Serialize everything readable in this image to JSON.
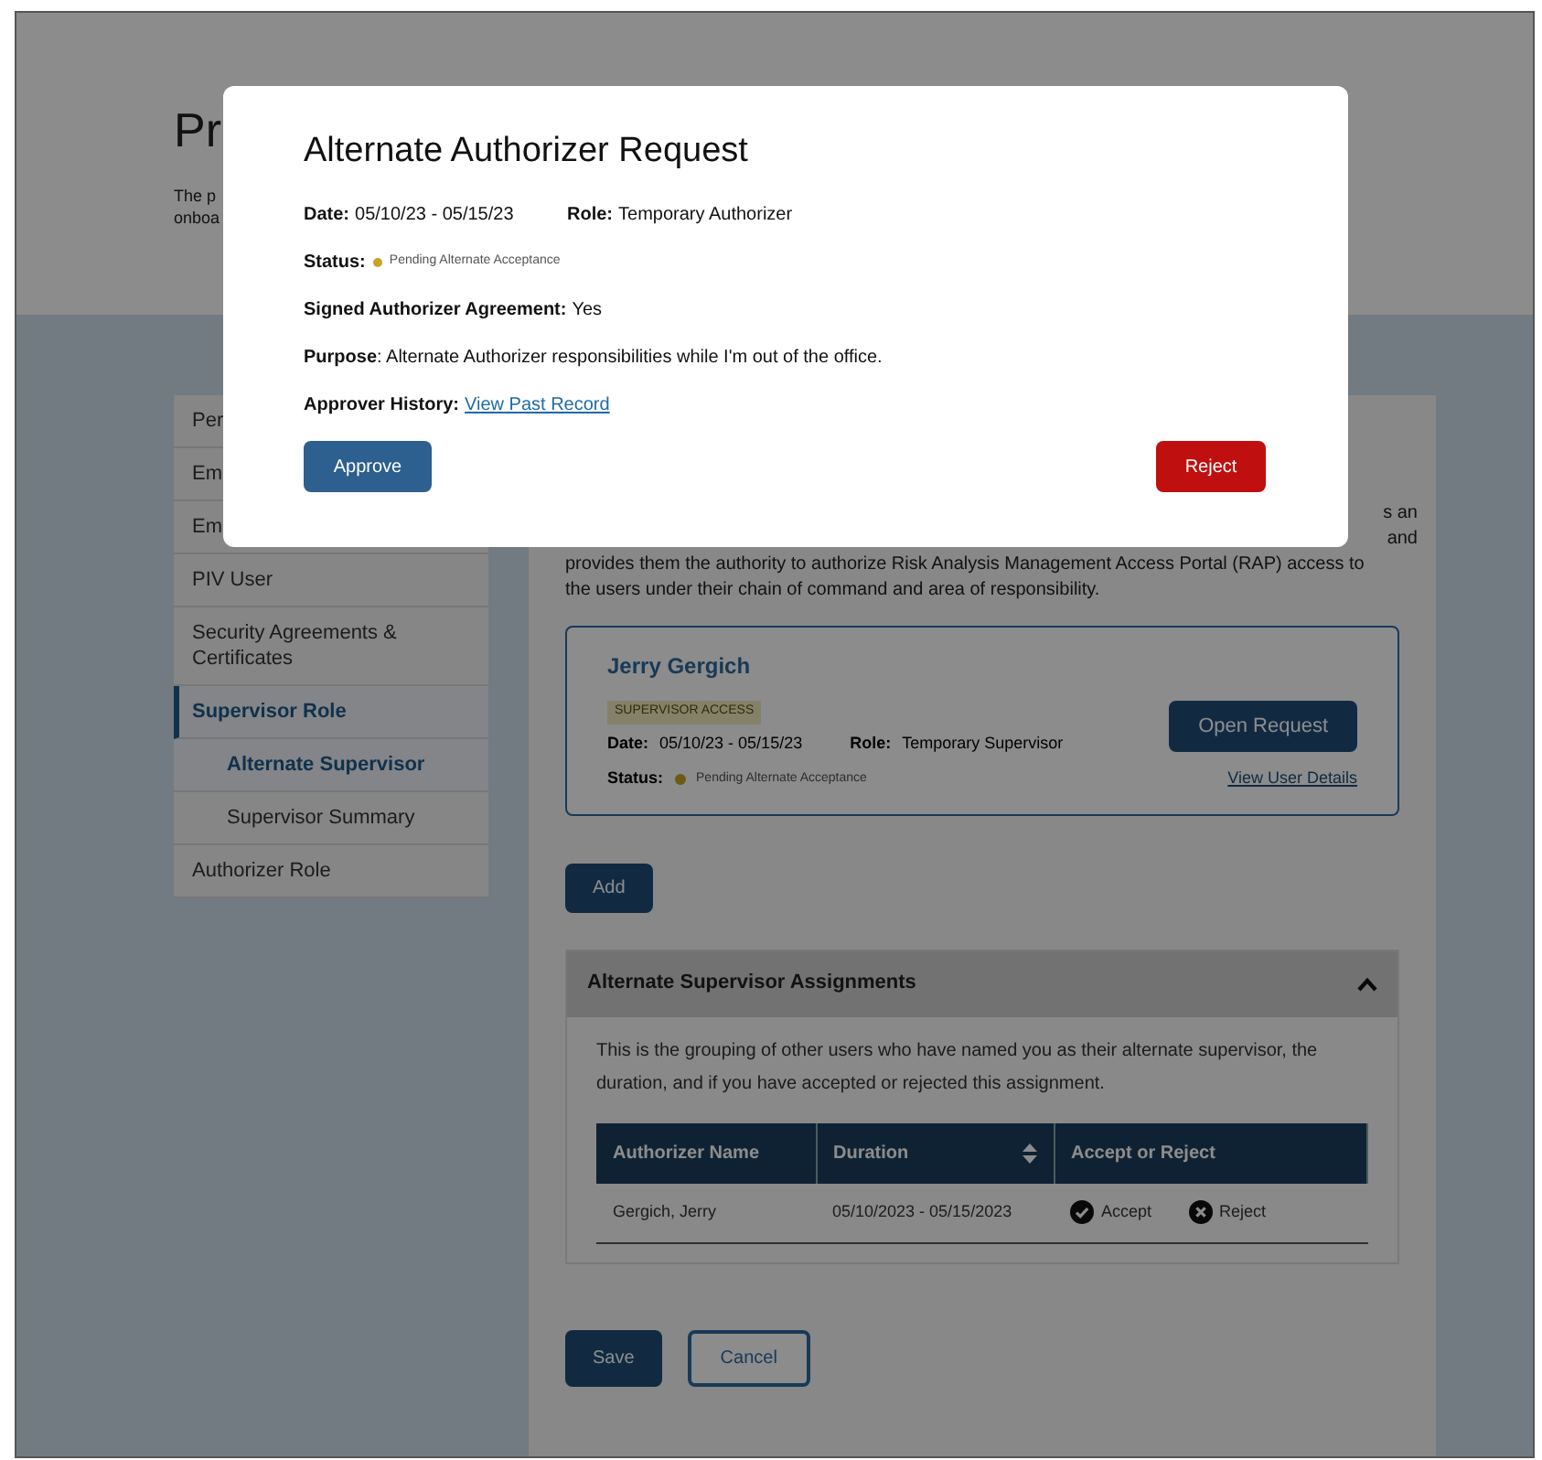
{
  "page": {
    "heading": "Pr",
    "intro_lines": [
      "The p",
      "onboa"
    ]
  },
  "sidebar": {
    "items": [
      {
        "label": "Per",
        "selected": false
      },
      {
        "label": "Em",
        "selected": false
      },
      {
        "label": "Em",
        "selected": false
      },
      {
        "label": "PIV User",
        "selected": false
      },
      {
        "label": "Security Agreements & Certificates",
        "selected": false
      },
      {
        "label": "Supervisor Role",
        "selected": true,
        "children": [
          {
            "label": "Alternate Supervisor",
            "selected": true
          },
          {
            "label": "Supervisor Summary",
            "selected": false
          }
        ]
      },
      {
        "label": "Authorizer Role",
        "selected": false
      }
    ]
  },
  "content": {
    "description_fragments": [
      "s an",
      "and"
    ],
    "description_lines": [
      "provides them the authority to authorize Risk Analysis Management Access Portal (RAP) access to",
      "the users under their chain of command and area of responsibility."
    ],
    "request_card": {
      "name": "Jerry Gergich",
      "badge": "SUPERVISOR ACCESS",
      "date_label": "Date:",
      "date": "05/10/23 - 05/15/23",
      "role_label": "Role:",
      "role": "Temporary Supervisor",
      "status_label": "Status:",
      "status": "Pending Alternate Acceptance",
      "open_button": "Open Request",
      "details_link": "View User Details"
    },
    "add_button": "Add",
    "accordion": {
      "title": "Alternate Supervisor Assignments",
      "expanded": true,
      "description": "This is the grouping of other users who have named you as their alternate supervisor, the duration, and if you have accepted or rejected this assignment.",
      "table": {
        "columns": [
          {
            "label": "Authorizer Name",
            "sortable": false
          },
          {
            "label": "Duration",
            "sortable": true
          },
          {
            "label": "Accept or Reject",
            "sortable": false
          }
        ],
        "rows": [
          {
            "name": "Gergich, Jerry",
            "duration": "05/10/2023 - 05/15/2023",
            "accept": "Accept",
            "reject": "Reject"
          }
        ]
      }
    },
    "save_button": "Save",
    "cancel_button": "Cancel"
  },
  "modal": {
    "title": "Alternate Authorizer Request",
    "date_label": "Date:",
    "date": "05/10/23 - 05/15/23",
    "role_label": "Role:",
    "role": "Temporary Authorizer",
    "status_label": "Status:",
    "status": "Pending Alternate Acceptance",
    "agreement_label": "Signed Authorizer Agreement:",
    "agreement": "Yes",
    "purpose_label": "Purpose",
    "purpose": ": Alternate Authorizer responsibilities while I'm out of the office.",
    "history_label": "Approver History:",
    "history_link": "View Past Record",
    "approve_button": "Approve",
    "reject_button": "Reject"
  }
}
